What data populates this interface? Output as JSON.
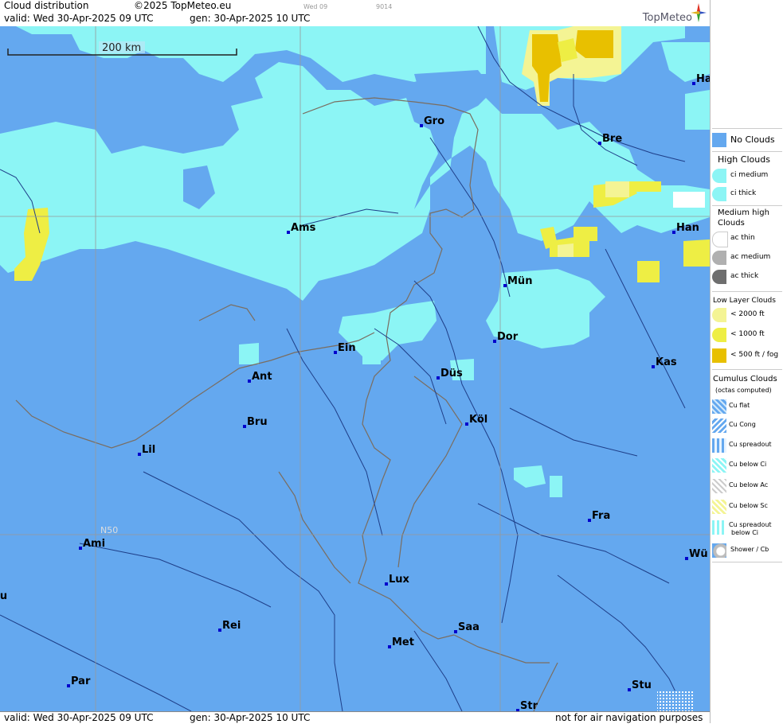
{
  "header": {
    "title": "Cloud distribution",
    "copyright": "©2025 TopMeteo.eu",
    "timebox_1": "Wed 09",
    "timebox_2": "9014",
    "valid_line": "valid:  Wed  30-Apr-2025  09 UTC",
    "gen_line": "gen:  30-Apr-2025 10 UTC",
    "logo_text": "TopMeteo"
  },
  "footer": {
    "valid_line": "valid:  Wed  30-Apr-2025  09 UTC",
    "gen_line": "gen:  30-Apr-2025 10 UTC",
    "disclaimer": "not for air navigation purposes"
  },
  "map": {
    "scale_label": "200 km",
    "grid_label": "N50",
    "colors": {
      "no_clouds": "#64a8ef",
      "ci_medium": "#8cf5f5",
      "low_2000": "#f4f494",
      "low_1000": "#eeee44",
      "low_500": "#e8c000",
      "border": "#7a6d60",
      "river": "#1e3e88",
      "grid": "#999999"
    },
    "cities": [
      {
        "name": "Gro"
      },
      {
        "name": "Bre"
      },
      {
        "name": "Ha"
      },
      {
        "name": "Ams"
      },
      {
        "name": "Han"
      },
      {
        "name": "Mün"
      },
      {
        "name": "Dor"
      },
      {
        "name": "Ein"
      },
      {
        "name": "Ant"
      },
      {
        "name": "Düs"
      },
      {
        "name": "Kas"
      },
      {
        "name": "Köl"
      },
      {
        "name": "Bru"
      },
      {
        "name": "Lil"
      },
      {
        "name": "Fra"
      },
      {
        "name": "Ami"
      },
      {
        "name": "Wü"
      },
      {
        "name": "ou"
      },
      {
        "name": "Lux"
      },
      {
        "name": "Rei"
      },
      {
        "name": "Saa"
      },
      {
        "name": "Met"
      },
      {
        "name": "Stu"
      },
      {
        "name": "Par"
      },
      {
        "name": "Str"
      }
    ]
  },
  "legend": {
    "no_clouds": "No Clouds",
    "high_title": "High Clouds",
    "ci_medium": "ci medium",
    "ci_thick": "ci thick",
    "medium_title_1": "Medium high",
    "medium_title_2": "Clouds",
    "ac_thin": "ac thin",
    "ac_medium": "ac medium",
    "ac_thick": "ac thick",
    "low_title": "Low Layer Clouds",
    "low_2000": "< 2000 ft",
    "low_1000": "< 1000 ft",
    "low_500": "< 500 ft / fog",
    "cumulus_title": "Cumulus Clouds",
    "cumulus_sub": "(octas computed)",
    "cu_flat": "Cu flat",
    "cu_cong": "Cu Cong",
    "cu_spreadout": "Cu spreadout",
    "cu_below_ci": "Cu below Ci",
    "cu_below_ac": "Cu below Ac",
    "cu_below_sc": "Cu below Sc",
    "cu_spread_ci_1": "Cu spreadout",
    "cu_spread_ci_2": "below Ci",
    "shower": "Shower / Cb"
  }
}
